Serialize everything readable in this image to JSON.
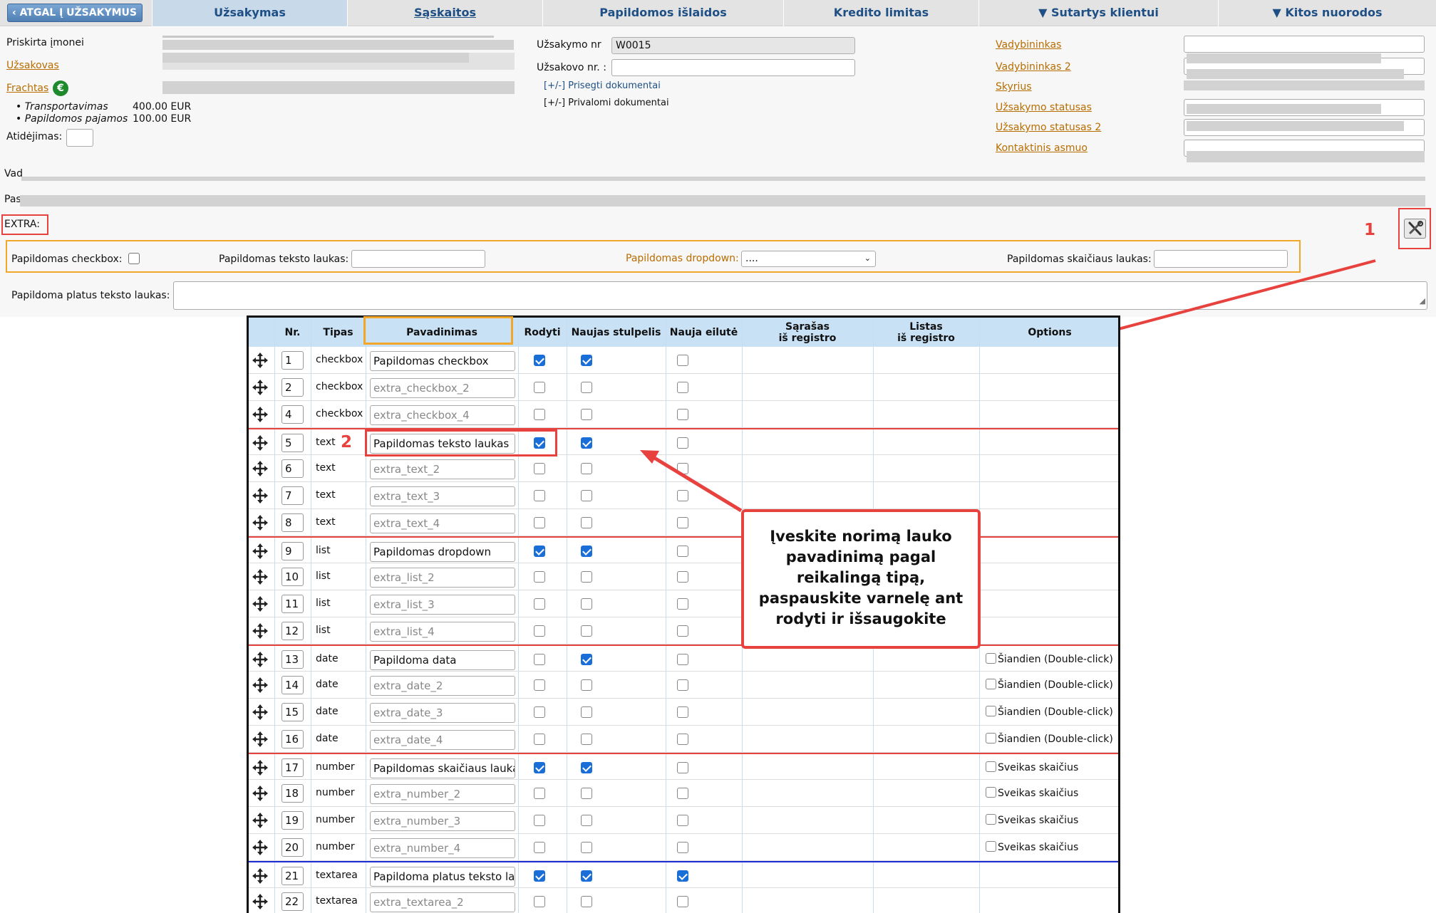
{
  "nav": {
    "back_label": "ATGAL Į UŽSAKYMUS",
    "tabs": [
      {
        "label": "Užsakymas"
      },
      {
        "label": "Sąskaitos"
      },
      {
        "label": "Papildomos išlaidos"
      },
      {
        "label": "Kredito limitas"
      },
      {
        "label": "▼ Sutartys klientui"
      },
      {
        "label": "▼ Kitos nuorodos"
      }
    ]
  },
  "order": {
    "priskirta_label": "Priskirta įmonei",
    "uzsakovas_label": "Užsakovas",
    "frachtas_label": "Frachtas",
    "transport_label": "Transportavimas",
    "transport_value": "400.00 EUR",
    "extra_income_label": "Papildomos pajamos",
    "extra_income_value": "100.00 EUR",
    "atidejimas_label": "Atidėjimas:",
    "order_nr_label": "Užsakymo nr",
    "order_nr_value": "W0015",
    "customer_nr_label": "Užsakovo nr. :",
    "attach_docs": "[+/-] Prisegti dokumentai",
    "required_docs": "[+/-] Privalomi dokumentai",
    "manager_label": "Vadybininkas",
    "manager2_label": "Vadybininkas 2",
    "department_label": "Skyrius",
    "status_label": "Užsakymo statusas",
    "status2_label": "Užsakymo statusas 2",
    "contact_label": "Kontaktinis asmuo",
    "vad_label": "Vad",
    "pas_label": "Pas"
  },
  "extra": {
    "title": "EXTRA:",
    "checkbox_label": "Papildomas checkbox:",
    "text_label": "Papildomas teksto laukas:",
    "dropdown_label": "Papildomas dropdown:",
    "dropdown_value": "....",
    "number_label": "Papildomas skaičiaus laukas:",
    "wide_text_label": "Papildoma platus teksto laukas:"
  },
  "annotations": {
    "one": "1",
    "two": "2",
    "callout": "Įveskite norimą lauko pavadinimą pagal reikalingą tipą, paspauskite varnelę ant rodyti ir išsaugokite"
  },
  "table": {
    "headers": {
      "nr": "Nr.",
      "tipas": "Tipas",
      "pavadinimas": "Pavadinimas",
      "rodyti": "Rodyti",
      "naujas_stulpelis": "Naujas stulpelis",
      "nauja_eilute": "Nauja eilutė",
      "sarasas_1": "Sąrašas",
      "sarasas_2": "iš registro",
      "listas_1": "Listas",
      "listas_2": "iš registro",
      "options": "Options"
    },
    "rows": [
      {
        "nr": "1",
        "tipas": "checkbox",
        "name": "Papildomas checkbox",
        "filled": true,
        "rodyti": true,
        "naujas": true,
        "nauja": false,
        "option": ""
      },
      {
        "nr": "2",
        "tipas": "checkbox",
        "name": "extra_checkbox_2",
        "filled": false,
        "rodyti": false,
        "naujas": false,
        "nauja": false,
        "option": ""
      },
      {
        "nr": "4",
        "tipas": "checkbox",
        "name": "extra_checkbox_4",
        "filled": false,
        "rodyti": false,
        "naujas": false,
        "nauja": false,
        "option": ""
      },
      {
        "nr": "5",
        "tipas": "text",
        "name": "Papildomas teksto laukas",
        "filled": true,
        "rodyti": true,
        "naujas": true,
        "nauja": false,
        "option": "",
        "sep": "red"
      },
      {
        "nr": "6",
        "tipas": "text",
        "name": "extra_text_2",
        "filled": false,
        "rodyti": false,
        "naujas": false,
        "nauja": false,
        "option": ""
      },
      {
        "nr": "7",
        "tipas": "text",
        "name": "extra_text_3",
        "filled": false,
        "rodyti": false,
        "naujas": false,
        "nauja": false,
        "option": ""
      },
      {
        "nr": "8",
        "tipas": "text",
        "name": "extra_text_4",
        "filled": false,
        "rodyti": false,
        "naujas": false,
        "nauja": false,
        "option": ""
      },
      {
        "nr": "9",
        "tipas": "list",
        "name": "Papildomas dropdown",
        "filled": true,
        "rodyti": true,
        "naujas": true,
        "nauja": false,
        "option": "",
        "sep": "red"
      },
      {
        "nr": "10",
        "tipas": "list",
        "name": "extra_list_2",
        "filled": false,
        "rodyti": false,
        "naujas": false,
        "nauja": false,
        "option": ""
      },
      {
        "nr": "11",
        "tipas": "list",
        "name": "extra_list_3",
        "filled": false,
        "rodyti": false,
        "naujas": false,
        "nauja": false,
        "option": ""
      },
      {
        "nr": "12",
        "tipas": "list",
        "name": "extra_list_4",
        "filled": false,
        "rodyti": false,
        "naujas": false,
        "nauja": false,
        "option": ""
      },
      {
        "nr": "13",
        "tipas": "date",
        "name": "Papildoma data",
        "filled": true,
        "rodyti": false,
        "naujas": true,
        "nauja": false,
        "option": "Šiandien (Double-click)",
        "sep": "red"
      },
      {
        "nr": "14",
        "tipas": "date",
        "name": "extra_date_2",
        "filled": false,
        "rodyti": false,
        "naujas": false,
        "nauja": false,
        "option": "Šiandien (Double-click)"
      },
      {
        "nr": "15",
        "tipas": "date",
        "name": "extra_date_3",
        "filled": false,
        "rodyti": false,
        "naujas": false,
        "nauja": false,
        "option": "Šiandien (Double-click)"
      },
      {
        "nr": "16",
        "tipas": "date",
        "name": "extra_date_4",
        "filled": false,
        "rodyti": false,
        "naujas": false,
        "nauja": false,
        "option": "Šiandien (Double-click)"
      },
      {
        "nr": "17",
        "tipas": "number",
        "name": "Papildomas skaičiaus lauka",
        "filled": true,
        "rodyti": true,
        "naujas": true,
        "nauja": false,
        "option": "Sveikas skaičius",
        "sep": "red"
      },
      {
        "nr": "18",
        "tipas": "number",
        "name": "extra_number_2",
        "filled": false,
        "rodyti": false,
        "naujas": false,
        "nauja": false,
        "option": "Sveikas skaičius"
      },
      {
        "nr": "19",
        "tipas": "number",
        "name": "extra_number_3",
        "filled": false,
        "rodyti": false,
        "naujas": false,
        "nauja": false,
        "option": "Sveikas skaičius"
      },
      {
        "nr": "20",
        "tipas": "number",
        "name": "extra_number_4",
        "filled": false,
        "rodyti": false,
        "naujas": false,
        "nauja": false,
        "option": "Sveikas skaičius"
      },
      {
        "nr": "21",
        "tipas": "textarea",
        "name": "Papildoma platus teksto lau",
        "filled": true,
        "rodyti": true,
        "naujas": true,
        "nauja": true,
        "option": "",
        "sep": "blue"
      },
      {
        "nr": "22",
        "tipas": "textarea",
        "name": "extra_textarea_2",
        "filled": false,
        "rodyti": false,
        "naujas": false,
        "nauja": false,
        "option": ""
      }
    ]
  },
  "colors": {
    "accent_red": "#e8423f",
    "accent_orange": "#f2a72a",
    "nav_text": "#1e4f85",
    "link_orange": "#b86d00",
    "header_blue": "#c9e1f5",
    "checkbox_blue": "#1a6ed8"
  }
}
